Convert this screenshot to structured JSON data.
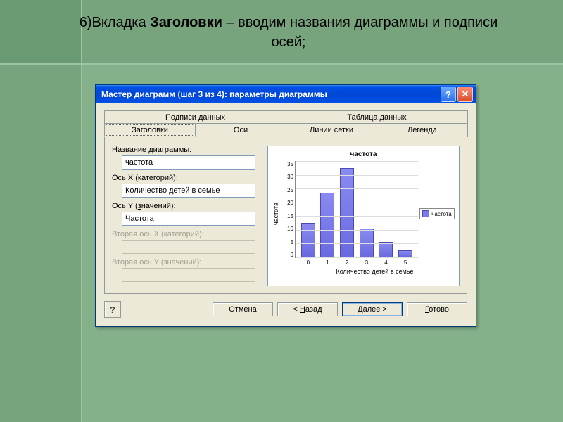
{
  "slide": {
    "caption_prefix": "6)Вкладка ",
    "caption_bold": "Заголовки",
    "caption_suffix": " – вводим названия диаграммы и подписи осей;"
  },
  "dialog": {
    "title": "Мастер диаграмм (шаг 3 из 4): параметры диаграммы",
    "help_glyph": "?",
    "close_glyph": "✕",
    "tabs_back": [
      "Подписи данных",
      "Таблица данных"
    ],
    "tabs_front": [
      "Заголовки",
      "Оси",
      "Линии сетки",
      "Легенда"
    ],
    "form": {
      "chart_title_label": "Название диаграммы:",
      "chart_title_value": "частота",
      "xaxis_label_pre": "Ось X (",
      "xaxis_label_u": "к",
      "xaxis_label_post": "атегорий):",
      "xaxis_value": "Количество детей в семье",
      "yaxis_label_pre": "Ось Y (",
      "yaxis_label_u": "з",
      "yaxis_label_post": "начений):",
      "yaxis_value": "Частота",
      "x2_label": "Вторая ось X (категорий):",
      "x2_value": "",
      "y2_label": "Вторая ось Y (значений):",
      "y2_value": ""
    },
    "buttons": {
      "help_icon": "?",
      "cancel": "Отмена",
      "back_pre": "< ",
      "back_u": "Н",
      "back_post": "азад",
      "next_u": "Д",
      "next_post": "алее >",
      "finish_u": "Г",
      "finish_post": "отово"
    }
  },
  "chart_data": {
    "type": "bar",
    "title": "частота",
    "xlabel": "Количество детей в семье",
    "ylabel": "частота",
    "categories": [
      "0",
      "1",
      "2",
      "3",
      "4",
      "5"
    ],
    "values": [
      12,
      23,
      32,
      10,
      5,
      2
    ],
    "ylim": [
      0,
      35
    ],
    "yticks": [
      "35",
      "30",
      "25",
      "20",
      "15",
      "10",
      "5",
      "0"
    ],
    "legend": "частота"
  }
}
